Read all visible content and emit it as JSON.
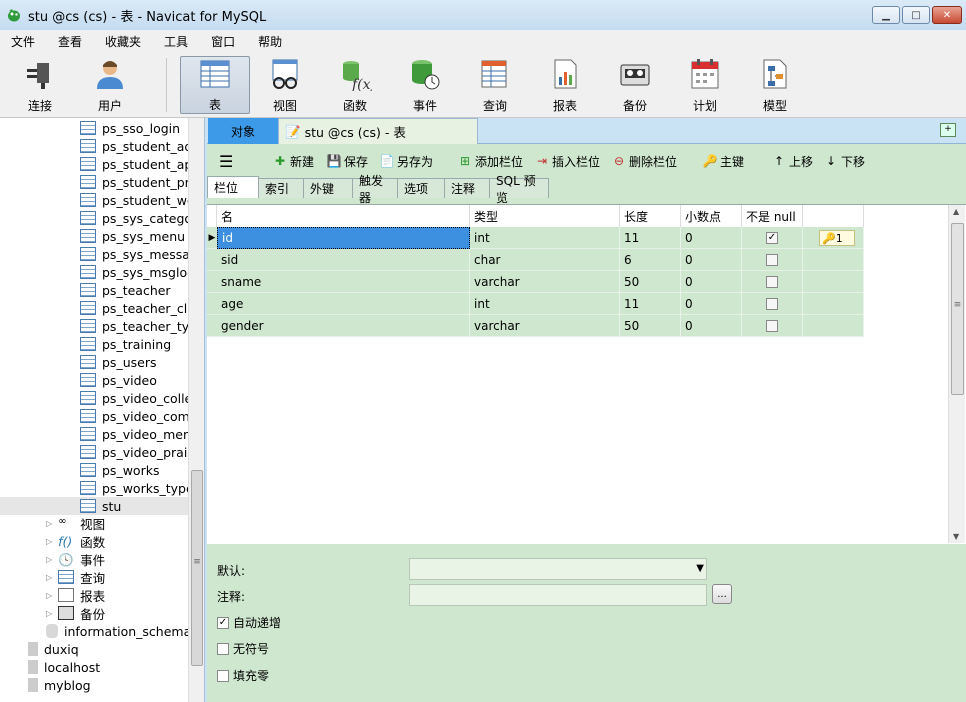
{
  "window": {
    "title": "stu @cs (cs) - 表 - Navicat for MySQL"
  },
  "menu": [
    "文件",
    "查看",
    "收藏夹",
    "工具",
    "窗口",
    "帮助"
  ],
  "toolbar": {
    "connect": "连接",
    "user": "用户",
    "table": "表",
    "view": "视图",
    "function": "函数",
    "event": "事件",
    "query": "查询",
    "report": "报表",
    "backup": "备份",
    "schedule": "计划",
    "model": "模型",
    "active": "表"
  },
  "sidebar": {
    "tables": [
      "ps_sso_login",
      "ps_student_ad",
      "ps_student_app",
      "ps_student_pro",
      "ps_student_wo",
      "ps_sys_categor",
      "ps_sys_menu",
      "ps_sys_messag",
      "ps_sys_msglog",
      "ps_teacher",
      "ps_teacher_clas",
      "ps_teacher_typ",
      "ps_training",
      "ps_users",
      "ps_video",
      "ps_video_colle",
      "ps_video_comr",
      "ps_video_menu",
      "ps_video_prais",
      "ps_works",
      "ps_works_type",
      "stu"
    ],
    "groups": [
      "视图",
      "函数",
      "事件",
      "查询",
      "报表",
      "备份"
    ],
    "databases": [
      "information_schema"
    ],
    "connections": [
      "duxiq",
      "localhost",
      "myblog"
    ]
  },
  "tabs": {
    "objects": "对象",
    "document": "stu @cs (cs) - 表"
  },
  "actions": {
    "new": "新建",
    "save": "保存",
    "save_as": "另存为",
    "add_field": "添加栏位",
    "insert_field": "插入栏位",
    "delete_field": "删除栏位",
    "primary_key": "主键",
    "move_up": "上移",
    "move_down": "下移"
  },
  "subtabs": [
    "栏位",
    "索引",
    "外键",
    "触发器",
    "选项",
    "注释",
    "SQL 预览"
  ],
  "grid": {
    "headers": [
      "名",
      "类型",
      "长度",
      "小数点",
      "不是 null"
    ],
    "rows": [
      {
        "name": "id",
        "type": "int",
        "length": "11",
        "decimals": "0",
        "not_null": true,
        "key": "1"
      },
      {
        "name": "sid",
        "type": "char",
        "length": "6",
        "decimals": "0",
        "not_null": false,
        "key": ""
      },
      {
        "name": "sname",
        "type": "varchar",
        "length": "50",
        "decimals": "0",
        "not_null": false,
        "key": ""
      },
      {
        "name": "age",
        "type": "int",
        "length": "11",
        "decimals": "0",
        "not_null": false,
        "key": ""
      },
      {
        "name": "gender",
        "type": "varchar",
        "length": "50",
        "decimals": "0",
        "not_null": false,
        "key": ""
      }
    ]
  },
  "props": {
    "default_label": "默认:",
    "comment_label": "注释:",
    "auto_increment": "自动递增",
    "auto_increment_checked": true,
    "unsigned": "无符号",
    "unsigned_checked": false,
    "zerofill": "填充零",
    "zerofill_checked": false,
    "dots": "..."
  }
}
